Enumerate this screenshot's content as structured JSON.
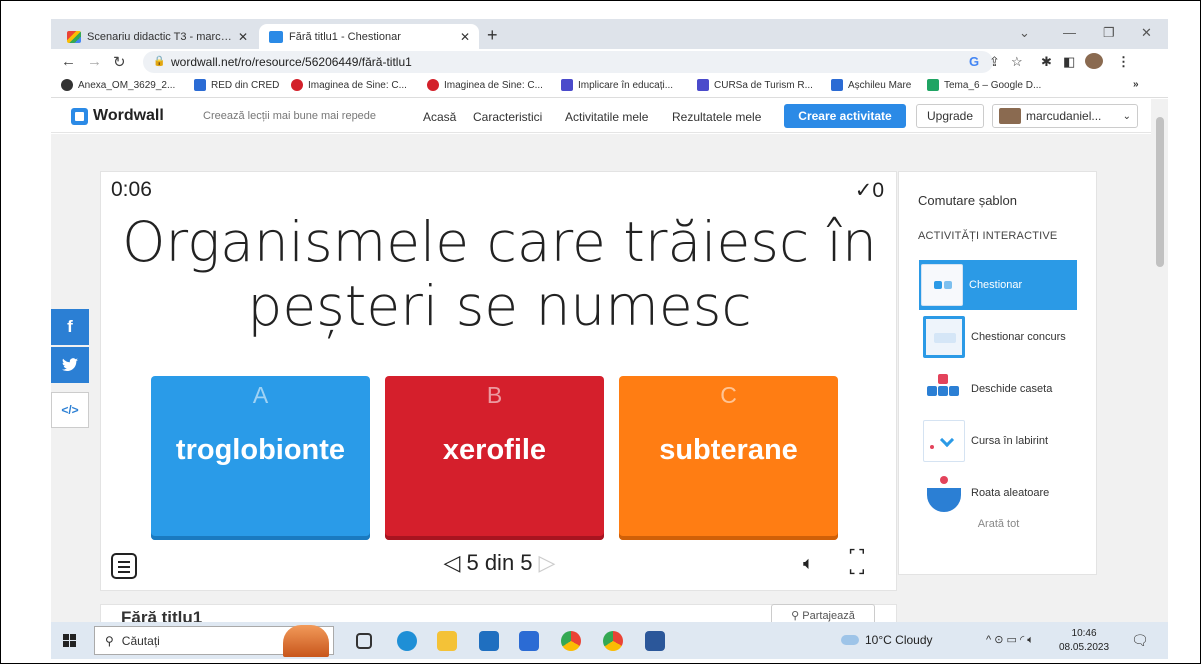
{
  "browser": {
    "tabs": [
      {
        "title": "Scenariu didactic T3 - marcudani...",
        "active": false
      },
      {
        "title": "Fără titlu1 - Chestionar",
        "active": true
      }
    ],
    "new_tab": "+",
    "close": "✕",
    "url": "wordwall.net/ro/resource/56206449/fără-titlu1",
    "bookmarks": [
      {
        "label": "Anexa_OM_3629_2...",
        "color": "#333333"
      },
      {
        "label": "RED din CRED",
        "color": "#2b6bd4"
      },
      {
        "label": "Imaginea de Sine: C...",
        "color": "#d3202a"
      },
      {
        "label": "Imaginea de Sine: C...",
        "color": "#d3202a"
      },
      {
        "label": "Implicare în educați...",
        "color": "#4a4acb"
      },
      {
        "label": "CURSa de Turism R...",
        "color": "#4a4acb"
      },
      {
        "label": "Așchileu Mare",
        "color": "#2b6bd4"
      },
      {
        "label": "Tema_6 – Google D...",
        "color": "#1fa463"
      }
    ],
    "bookmarks_more": "»"
  },
  "wordwall": {
    "logo": "Wordwall",
    "tagline": "Creează lecții mai bune mai repede",
    "nav": [
      "Acasă",
      "Caracteristici",
      "Activitatile mele",
      "Rezultatele mele"
    ],
    "create_button": "Creare activitate",
    "upgrade_button": "Upgrade",
    "user": "marcudaniel..."
  },
  "share": {
    "facebook": "f",
    "embed": "</>"
  },
  "game": {
    "timer": "0:06",
    "score": "✓0",
    "question": "Organismele care trăiesc în peșteri se numesc",
    "answers": [
      {
        "letter": "A",
        "text": "troglobionte",
        "color": "#2a9be8"
      },
      {
        "letter": "B",
        "text": "xerofile",
        "color": "#d51f2c"
      },
      {
        "letter": "C",
        "text": "subterane",
        "color": "#ff7d13"
      }
    ],
    "pager": "5 din 5"
  },
  "templates": {
    "title": "Comutare șablon",
    "subtitle": "ACTIVITĂȚI INTERACTIVE",
    "items": [
      {
        "label": "Chestionar",
        "active": true
      },
      {
        "label": "Chestionar concurs",
        "active": false
      },
      {
        "label": "Deschide caseta",
        "active": false
      },
      {
        "label": "Cursa în labirint",
        "active": false
      },
      {
        "label": "Roata aleatoare",
        "active": false
      }
    ],
    "show_all": "Arată tot"
  },
  "below": {
    "title": "Fără titlu1",
    "share_button": "Partajează"
  },
  "taskbar": {
    "search_placeholder": "Căutați",
    "weather": "10°C  Cloudy",
    "time": "10:46",
    "date": "08.05.2023"
  }
}
